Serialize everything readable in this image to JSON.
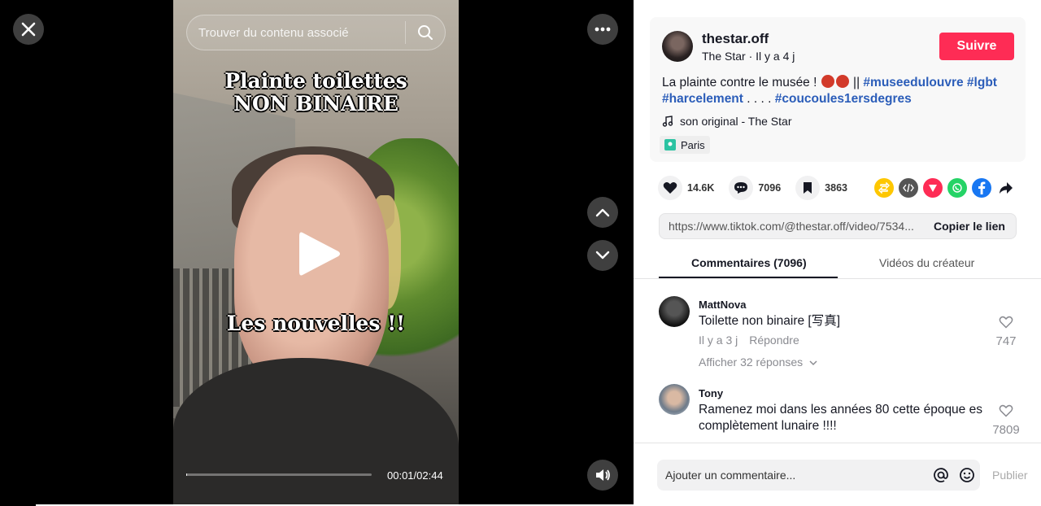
{
  "video": {
    "search_placeholder": "Trouver du contenu associé",
    "title_line1": "Plainte toilettes",
    "title_line2": "NON BINAIRE",
    "caption": "Les nouvelles !!",
    "time": "00:01/02:44",
    "progress": 0.006
  },
  "post": {
    "username": "thestar.off",
    "subtitle": "The Star · Il y a 4 j",
    "follow_label": "Suivre",
    "desc_text": "La plainte contre le musée !",
    "desc_sep": "||",
    "tags_line1": [
      "#museedulouvre",
      "#lgbt"
    ],
    "tag_harcelement": "#harcelement",
    "dots": ". . . .",
    "tag_last": "#coucoules1ersdegres",
    "music": "son original - The Star",
    "location": "Paris"
  },
  "stats": {
    "likes": "14.6K",
    "comments": "7096",
    "saves": "3863"
  },
  "share": {
    "url": "https://www.tiktok.com/@thestar.off/video/7534...",
    "copy_label": "Copier le lien"
  },
  "tabs": {
    "comments": "Commentaires (7096)",
    "creator": "Vidéos du créateur"
  },
  "comments": [
    {
      "name": "MattNova",
      "text": "Toilette non binaire [写真]",
      "time": "Il y a 3 j",
      "reply": "Répondre",
      "likes": "747",
      "more": "Afficher 32 réponses"
    },
    {
      "name": "Tony",
      "text": "Ramenez moi dans les années 80 cette époque es complètement lunaire !!!!",
      "likes": "7809"
    }
  ],
  "footer": {
    "placeholder": "Ajouter un commentaire...",
    "post": "Publier"
  },
  "colors": {
    "accent": "#fe2c55",
    "tag": "#2b5db9"
  }
}
